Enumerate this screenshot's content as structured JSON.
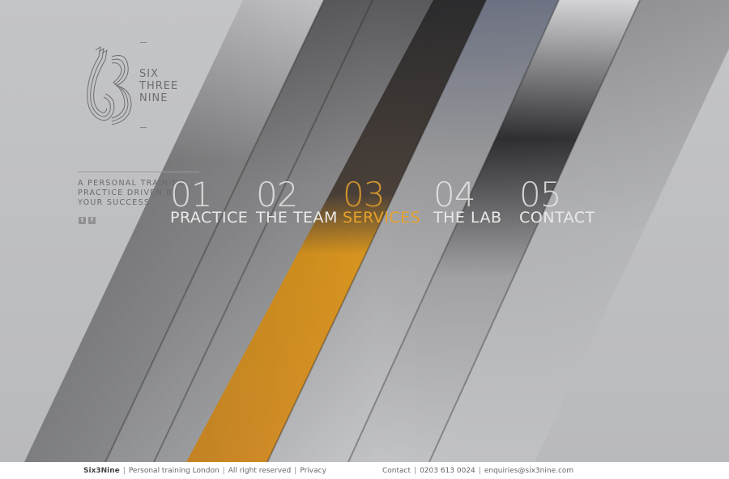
{
  "brand": {
    "logo_glyph": "3",
    "words": [
      "SIX",
      "THREE",
      "NINE"
    ],
    "tagline": [
      "A PERSONAL TRAINING",
      "PRACTICE DRIVEN BY",
      "YOUR SUCCESS"
    ]
  },
  "social": [
    {
      "name": "twitter-icon",
      "glyph": "t"
    },
    {
      "name": "facebook-icon",
      "glyph": "f"
    }
  ],
  "nav": [
    {
      "num": "01",
      "label": "PRACTICE",
      "active": false
    },
    {
      "num": "02",
      "label": "THE TEAM",
      "active": false
    },
    {
      "num": "03",
      "label": "SERVICES",
      "active": true
    },
    {
      "num": "04",
      "label": "THE LAB",
      "active": false
    },
    {
      "num": "05",
      "label": "CONTACT",
      "active": false
    }
  ],
  "footer": {
    "brand": "Six3Nine",
    "tagline": "Personal training London",
    "rights": "All right reserved",
    "privacy": "Privacy",
    "contact": "Contact",
    "phone": "0203 613 0024",
    "email": "enquiries@six3nine.com"
  },
  "colors": {
    "accent": "#e7a22a",
    "background": "#c4c5c8",
    "footer_bg": "#ffffff"
  }
}
